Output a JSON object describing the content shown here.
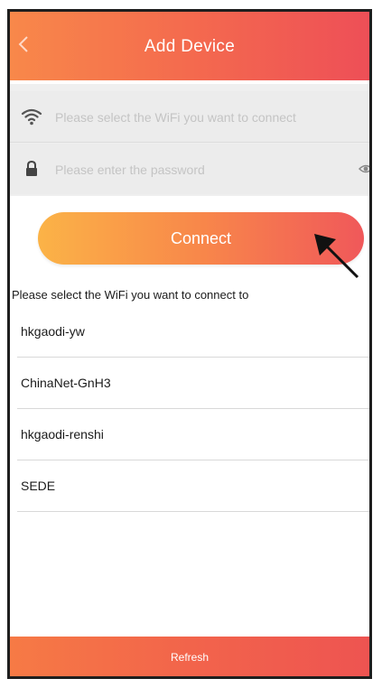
{
  "header": {
    "title": "Add Device",
    "back_icon": "chevron-left-icon"
  },
  "form": {
    "wifi_placeholder": "Please select the WiFi you want to connect",
    "wifi_icon": "wifi-icon",
    "password_placeholder": "Please enter the password",
    "password_icon": "lock-icon",
    "visibility_icon": "eye-icon"
  },
  "connect_button": {
    "label": "Connect"
  },
  "wifi_prompt": "Please select the WiFi you want to connect to",
  "wifi_networks": [
    "hkgaodi-yw",
    "ChinaNet-GnH3",
    "hkgaodi-renshi",
    "SEDE"
  ],
  "refresh_button": {
    "label": "Refresh"
  },
  "colors": {
    "header_start": "#f8884a",
    "header_end": "#ee4f57",
    "button_start": "#fbb347",
    "button_end": "#f0585a",
    "refresh_bar": "#f2644b",
    "form_background": "#efefef"
  }
}
